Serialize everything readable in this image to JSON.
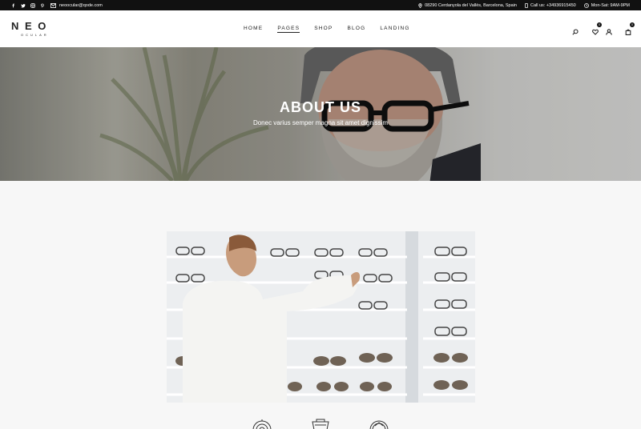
{
  "topbar": {
    "social": [
      "facebook-icon",
      "twitter-icon",
      "instagram-icon",
      "pinterest-icon"
    ],
    "email": "neoocular@qode.com",
    "address": "08290 Cerdanyola del Vallès, Barcelona, Spain",
    "phone": "Call us: +34936915450",
    "hours": "Mon-Sat: 9AM-9PM"
  },
  "header": {
    "logo_word": "N E O",
    "logo_sub": "OCULAR",
    "nav": [
      "HOME",
      "PAGES",
      "SHOP",
      "BLOG",
      "LANDING"
    ],
    "active_nav": "PAGES",
    "wishlist_count": "0",
    "cart_count": "0"
  },
  "hero": {
    "title": "ABOUT US",
    "subtitle": "Donec varius semper magna sit amet dignissim"
  },
  "colors": {
    "topbar_bg": "#111111",
    "header_bg": "#ffffff",
    "page_bg": "#f7f7f7",
    "text": "#222222"
  },
  "icons": {
    "search": "search-icon",
    "wishlist": "heart-icon",
    "account": "user-icon",
    "cart": "bag-icon"
  }
}
